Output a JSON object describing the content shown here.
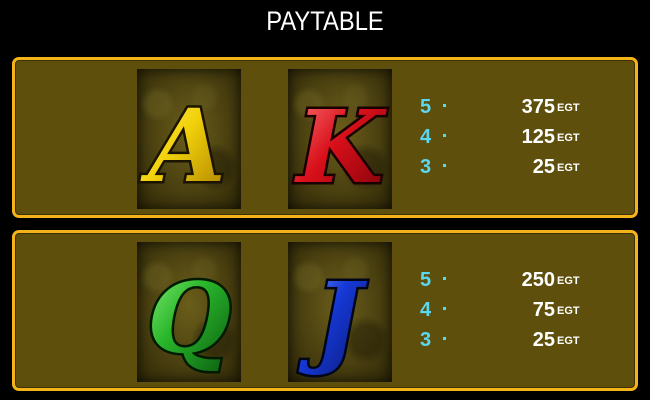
{
  "title": "PAYTABLE",
  "currency": "EGT",
  "panels": [
    {
      "symbols": [
        {
          "letter": "A",
          "icon": "letter-a-icon",
          "color": "#f2d20a"
        },
        {
          "letter": "K",
          "icon": "letter-k-icon",
          "color": "#d8101a"
        }
      ],
      "pays": [
        {
          "count": "5",
          "value": "375",
          "unit": "EGT"
        },
        {
          "count": "4",
          "value": "125",
          "unit": "EGT"
        },
        {
          "count": "3",
          "value": "25",
          "unit": "EGT"
        }
      ]
    },
    {
      "symbols": [
        {
          "letter": "Q",
          "icon": "letter-q-icon",
          "color": "#28b52a"
        },
        {
          "letter": "J",
          "icon": "letter-j-icon",
          "color": "#1638d6"
        }
      ],
      "pays": [
        {
          "count": "5",
          "value": "250",
          "unit": "EGT"
        },
        {
          "count": "4",
          "value": "75",
          "unit": "EGT"
        },
        {
          "count": "3",
          "value": "25",
          "unit": "EGT"
        }
      ]
    }
  ],
  "colors": {
    "background": "#000000",
    "panel_fill": "#5e4f0c",
    "panel_border": "#f5b31a",
    "count_color": "#5ad8f2",
    "value_color": "#ffffff"
  }
}
